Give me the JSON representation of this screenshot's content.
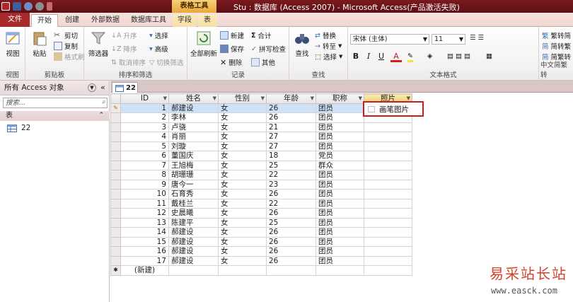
{
  "window": {
    "title": "Stu : 数据库 (Access 2007) - Microsoft Access(产品激活失败)",
    "context_group": "表格工具"
  },
  "tabs": [
    "文件",
    "开始",
    "创建",
    "外部数据",
    "数据库工具",
    "字段",
    "表"
  ],
  "ribbon": {
    "views": {
      "view": "视图",
      "label": "视图"
    },
    "clipboard": {
      "paste": "粘贴",
      "cut": "剪切",
      "copy": "复制",
      "format_painter": "格式刷",
      "label": "剪贴板"
    },
    "sort_filter": {
      "filter": "筛选器",
      "asc": "升序",
      "desc": "降序",
      "remove_sort": "取消排序",
      "selection": "选择",
      "advanced": "高级",
      "toggle_filter": "切换筛选",
      "label": "排序和筛选"
    },
    "records": {
      "refresh_all": "全部刷新",
      "new": "新建",
      "save": "保存",
      "delete": "删除",
      "totals": "合计",
      "spelling": "拼写检查",
      "more": "其他",
      "label": "记录"
    },
    "find": {
      "find": "查找",
      "replace": "替换",
      "goto": "转至",
      "select": "选择",
      "label": "查找"
    },
    "text_format": {
      "font": "宋体 (主体)",
      "size": "11",
      "bold": "B",
      "italic": "I",
      "underline": "U",
      "font_color": "A",
      "label": "文本格式"
    },
    "chinese_conv": {
      "s2t": "繁转简",
      "t2s": "简转繁",
      "conv": "简繁转",
      "label": "中文简繁转"
    }
  },
  "nav": {
    "header": "所有 Access 对象",
    "search_placeholder": "搜索...",
    "category": "表",
    "items": [
      {
        "name": "22"
      }
    ]
  },
  "document": {
    "tab": "22",
    "columns": [
      "ID",
      "姓名",
      "性别",
      "年龄",
      "职称",
      "照片"
    ],
    "rows": [
      [
        "1",
        "郝建设",
        "女",
        "26",
        "团员"
      ],
      [
        "2",
        "李林",
        "女",
        "26",
        "团员"
      ],
      [
        "3",
        "卢骁",
        "女",
        "21",
        "团员"
      ],
      [
        "4",
        "肖丽",
        "女",
        "27",
        "团员"
      ],
      [
        "5",
        "刘璇",
        "女",
        "27",
        "团员"
      ],
      [
        "6",
        "董国庆",
        "女",
        "18",
        "党员"
      ],
      [
        "7",
        "王旭梅",
        "女",
        "25",
        "群众"
      ],
      [
        "8",
        "胡珊珊",
        "女",
        "22",
        "团员"
      ],
      [
        "9",
        "唐今一",
        "女",
        "23",
        "团员"
      ],
      [
        "10",
        "石育秀",
        "女",
        "26",
        "团员"
      ],
      [
        "11",
        "戴桂兰",
        "女",
        "22",
        "团员"
      ],
      [
        "12",
        "史晨曦",
        "女",
        "26",
        "团员"
      ],
      [
        "13",
        "陈建平",
        "女",
        "25",
        "团员"
      ],
      [
        "14",
        "郝建设",
        "女",
        "26",
        "团员"
      ],
      [
        "15",
        "郝建设",
        "女",
        "26",
        "团员"
      ],
      [
        "16",
        "郝建设",
        "女",
        "26",
        "团员"
      ],
      [
        "17",
        "郝建设",
        "女",
        "26",
        "团员"
      ]
    ],
    "new_row_label": "(新建)",
    "photo_value": "画笔图片"
  },
  "watermark": {
    "line1": "易采站长站",
    "line2": "www.easck.com"
  },
  "colors": {
    "title_bar": "#7a1a1f",
    "file_tab": "#a72a2a",
    "highlight": "#d11b1b",
    "current_row": "#cfe1f7"
  }
}
